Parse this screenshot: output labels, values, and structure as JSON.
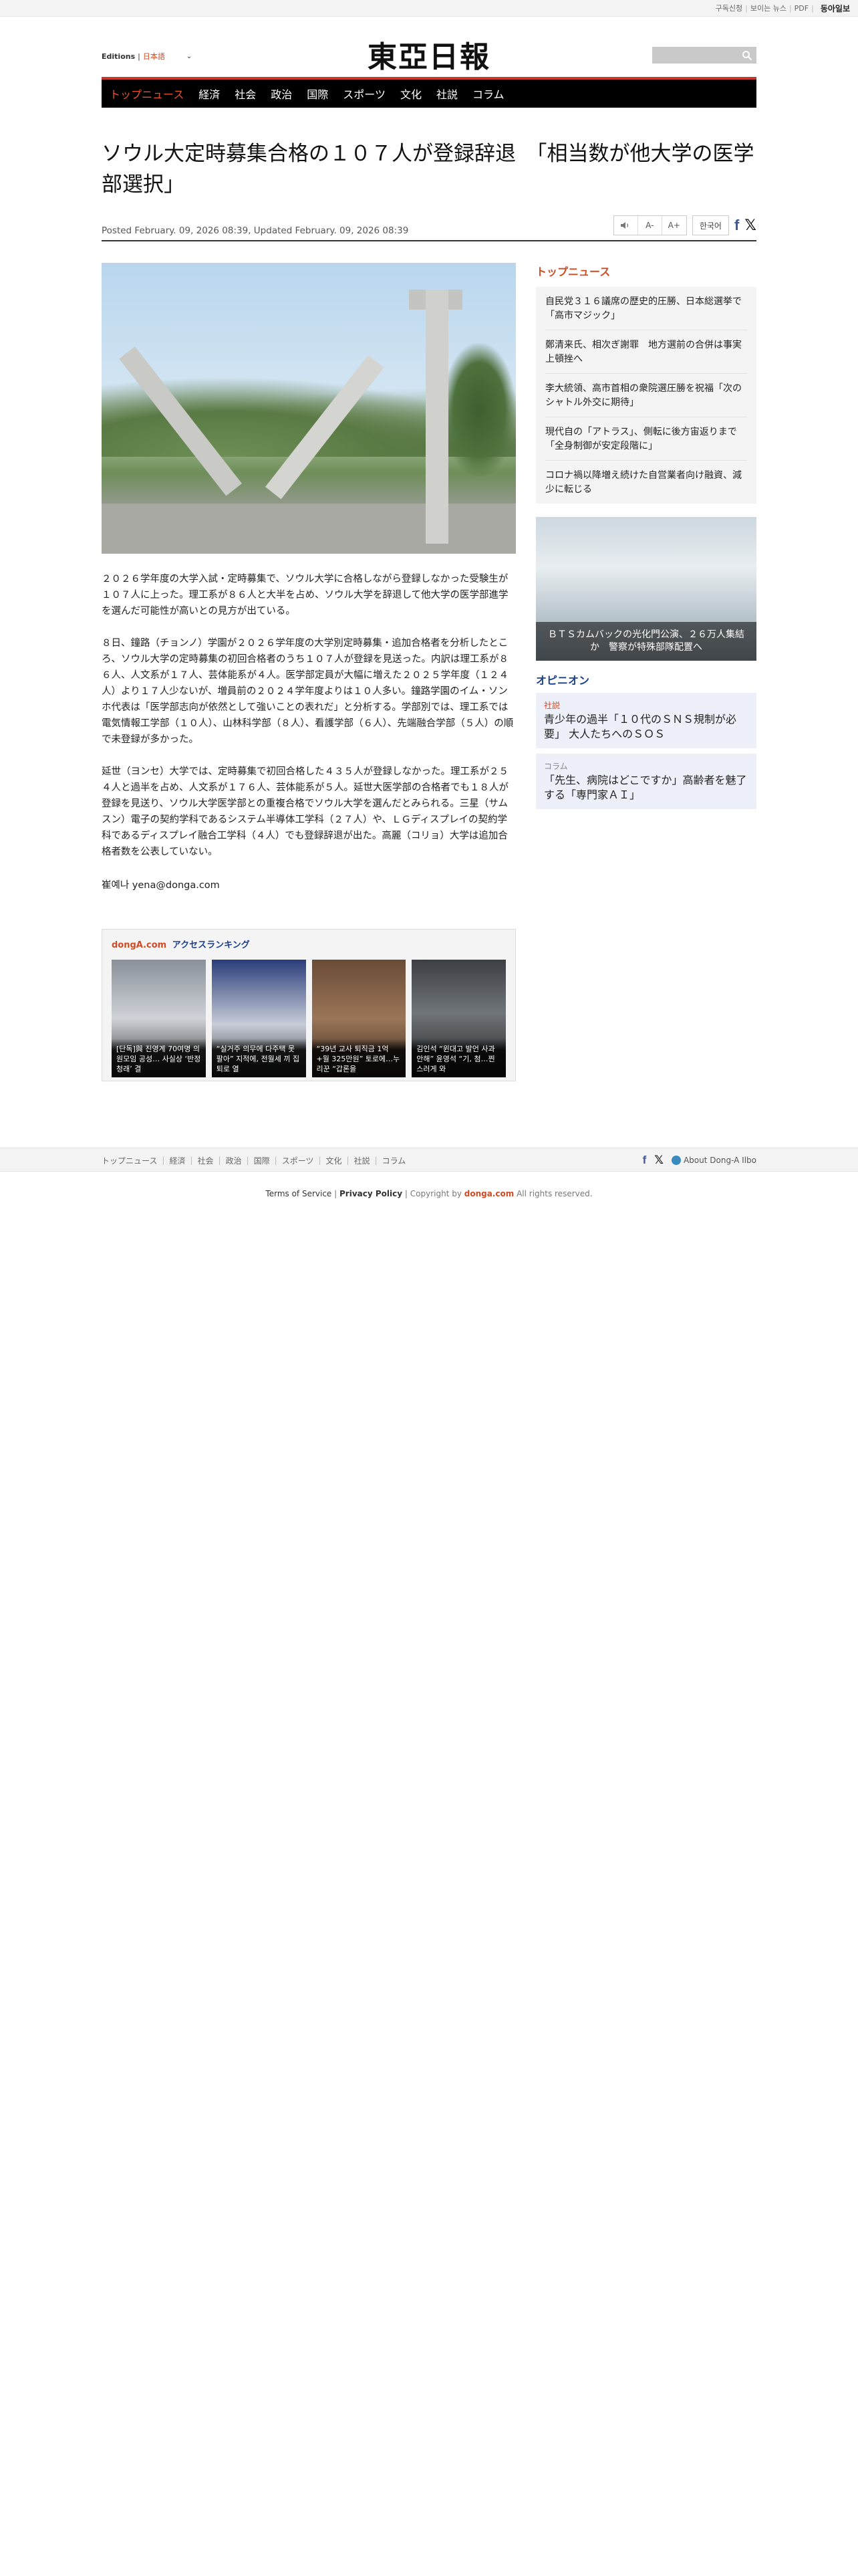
{
  "util": {
    "links": [
      "구독신청",
      "보이는 뉴스",
      "PDF"
    ],
    "brand": "동아일보"
  },
  "header": {
    "editions_label": "Editions",
    "edition_value": "日本語",
    "logo": "東亞日報",
    "search_placeholder": ""
  },
  "nav": [
    "トップニュース",
    "経済",
    "社会",
    "政治",
    "国際",
    "スポーツ",
    "文化",
    "社説",
    "コラム"
  ],
  "article": {
    "headline": "ソウル大定時募集合格の１０７人が登録辞退　「相当数が他大学の医学部選択」",
    "posted": "Posted February. 09, 2026 08:39,",
    "updated": "Updated February. 09, 2026 08:39",
    "font_minus": "A-",
    "font_plus": "A+",
    "korean_btn": "한국어",
    "paragraphs": [
      "２０２６学年度の大学入試・定時募集で、ソウル大学に合格しながら登録しなかった受験生が１０７人に上った。理工系が８６人と大半を占め、ソウル大学を辞退して他大学の医学部進学を選んだ可能性が高いとの見方が出ている。",
      "８日、鐘路（チョンノ）学園が２０２６学年度の大学別定時募集・追加合格者を分析したところ、ソウル大学の定時募集の初回合格者のうち１０７人が登録を見送った。内訳は理工系が８６人、人文系が１７人、芸体能系が４人。医学部定員が大幅に増えた２０２５学年度（１２４人）より１７人少ないが、増員前の２０２４学年度よりは１０人多い。鐘路学園のイム・ソンホ代表は「医学部志向が依然として強いことの表れだ」と分析する。学部別では、理工系では電気情報工学部（１０人）、山林科学部（８人）、看護学部（６人）、先端融合学部（５人）の順で未登録が多かった。",
      "延世（ヨンセ）大学では、定時募集で初回合格した４３５人が登録しなかった。理工系が２５４人と過半を占め、人文系が１７６人、芸体能系が５人。延世大医学部の合格者でも１８人が登録を見送り、ソウル大学医学部との重複合格でソウル大学を選んだとみられる。三星（サムスン）電子の契約学科であるシステム半導体工学科（２７人）や、ＬＧディスプレイの契約学科であるディスプレイ融合工学科（４人）でも登録辞退が出た。高麗（コリョ）大学は追加合格者数を公表していない。"
    ],
    "byline": "崔예나 yena@donga.com"
  },
  "ranking": {
    "brand": "dongA.com",
    "title": "アクセスランキング",
    "items": [
      "[단독]與 진영계 70여명 의원모임 공성… 사실상 ‘반정청래’ 결",
      "“실거주 의무에 다주택 못팔아” 지적에, 전월세 끼 집 퇴로 열",
      "“39년 교사 퇴직금 1억+월 325만원” 토로에…누리꾼 “갑론을",
      "김인석 “윈대고 발언 사과 안해” 윤영석 “기, 첨…찐스러게 와"
    ]
  },
  "aside": {
    "top_title": "トップニュース",
    "top_news": [
      "自民党３１６議席の歴史的圧勝、日本総選挙で「高市マジック」",
      "鄭清来氏、相次ぎ謝罪　地方選前の合併は事実上頓挫へ",
      "李大統領、高市首相の衆院選圧勝を祝福「次のシャトル外交に期待」",
      "現代自の「アトラス」、側転に後方宙返りまで　「全身制御が安定段階に」",
      "コロナ禍以降増え続けた自営業者向け融資、減少に転じる"
    ],
    "promo_caption": "ＢＴＳカムバックの光化門公演、２６万人集結か　警察が特殊部隊配置へ",
    "opinion_title": "オピニオン",
    "opinions": [
      {
        "tag": "社説",
        "text": "青少年の過半「１０代のＳＮＳ規制が必要」 大人たちへのＳＯＳ"
      },
      {
        "tag": "コラム",
        "text": "「先生、病院はどこですか」高齢者を魅了する「専門家ＡＩ」"
      }
    ]
  },
  "footer": {
    "links": [
      "トップニュース",
      "経済",
      "社会",
      "政治",
      "国際",
      "スポーツ",
      "文化",
      "社説",
      "コラム"
    ],
    "about": "About Dong-A Ilbo",
    "terms": "Terms of Service",
    "privacy": "Privacy Policy",
    "copyright_prefix": "Copyright by",
    "copyright_brand": "donga.com",
    "copyright_suffix": "All rights reserved."
  }
}
